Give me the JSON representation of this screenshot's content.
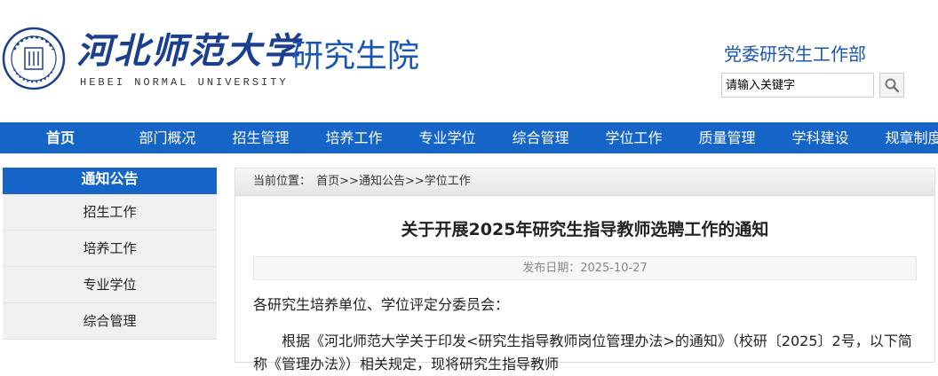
{
  "header": {
    "logo_cn": "河北师范大学",
    "logo_en": "HEBEI NORMAL UNIVERSITY",
    "site_title": "研究生院",
    "dept_link": "党委研究生工作部",
    "search_placeholder": "请输入关键字",
    "colors": {
      "brand": "#1565c9",
      "title": "#1a57b4"
    },
    "icons": {
      "logo": "university-seal-icon",
      "search": "search-icon"
    }
  },
  "nav": {
    "items": [
      "首页",
      "部门概况",
      "招生管理",
      "培养工作",
      "专业学位",
      "综合管理",
      "学位工作",
      "质量管理",
      "学科建设",
      "规章制度"
    ]
  },
  "sidebar": {
    "title": "通知公告",
    "items": [
      "招生工作",
      "培养工作",
      "专业学位",
      "综合管理"
    ]
  },
  "breadcrumb": {
    "label": "当前位置：",
    "path": "首页>>通知公告>>学位工作"
  },
  "article": {
    "title": "关于开展2025年研究生指导教师选聘工作的通知",
    "date": "发布日期：2025-10-27",
    "salutation": "各研究生培养单位、学位评定分委员会：",
    "paragraph": "根据《河北师范大学关于印发<研究生指导教师岗位管理办法>的通知》（校研〔2025〕2号，以下简称《管理办法》）相关规定，现将研究生指导教师"
  }
}
